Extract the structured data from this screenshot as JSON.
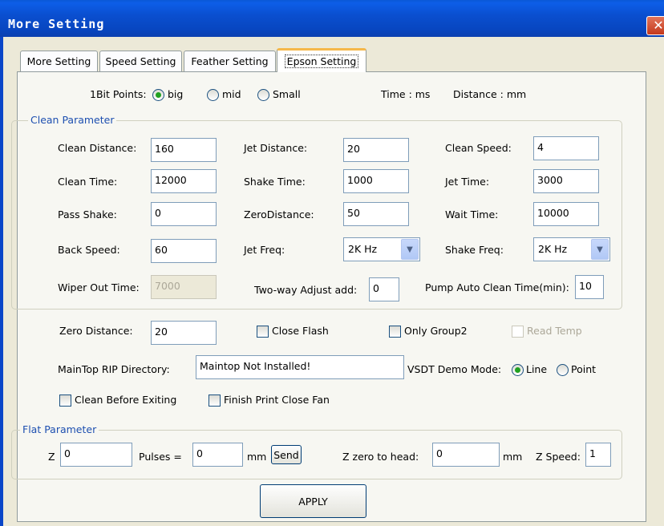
{
  "window": {
    "title": "More Setting",
    "close_glyph": "✕"
  },
  "tabs": [
    {
      "label": "More Setting"
    },
    {
      "label": "Speed Setting"
    },
    {
      "label": "Feather Setting"
    },
    {
      "label": "Epson Setting"
    }
  ],
  "bit_points": {
    "label": "1Bit Points:",
    "options": [
      "big",
      "mid",
      "Small"
    ],
    "selected": "big",
    "time_unit": "Time : ms",
    "distance_unit": "Distance : mm"
  },
  "clean": {
    "group_title": "Clean Parameter",
    "clean_distance": {
      "label": "Clean Distance:",
      "value": "160"
    },
    "jet_distance": {
      "label": "Jet Distance:",
      "value": "20"
    },
    "clean_speed": {
      "label": "Clean Speed:",
      "value": "4"
    },
    "clean_time": {
      "label": "Clean Time:",
      "value": "12000"
    },
    "shake_time": {
      "label": "Shake Time:",
      "value": "1000"
    },
    "jet_time": {
      "label": "Jet Time:",
      "value": "3000"
    },
    "pass_shake": {
      "label": "Pass Shake:",
      "value": "0"
    },
    "zero_distance": {
      "label": "ZeroDistance:",
      "value": "50"
    },
    "wait_time": {
      "label": "Wait Time:",
      "value": "10000"
    },
    "back_speed": {
      "label": "Back Speed:",
      "value": "60"
    },
    "jet_freq": {
      "label": "Jet Freq:",
      "value": "2K Hz"
    },
    "shake_freq": {
      "label": "Shake Freq:",
      "value": "2K Hz"
    },
    "wiper_out_time": {
      "label": "Wiper Out Time:",
      "value": "7000"
    },
    "two_way_adjust": {
      "label": "Two-way Adjust add:",
      "value": "0"
    },
    "pump_auto_clean": {
      "label": "Pump Auto Clean Time(min):",
      "value": "10"
    }
  },
  "misc": {
    "zero_distance": {
      "label": "Zero Distance:",
      "value": "20"
    },
    "close_flash": {
      "label": "Close Flash",
      "checked": false
    },
    "only_group2": {
      "label": "Only Group2",
      "checked": false
    },
    "read_temp": {
      "label": "Read Temp",
      "checked": false
    },
    "maintop_dir": {
      "label": "MainTop RIP Directory:",
      "value": "Maintop Not Installed!"
    },
    "vsdt_mode": {
      "label": "VSDT Demo Mode:",
      "options": [
        "Line",
        "Point"
      ],
      "selected": "Line"
    },
    "clean_before_exit": {
      "label": "Clean Before Exiting",
      "checked": false
    },
    "finish_close_fan": {
      "label": "Finish Print Close Fan",
      "checked": false
    }
  },
  "flat": {
    "group_title": "Flat Parameter",
    "z_label": "Z",
    "z_value": "0",
    "pulses_label": "Pulses =",
    "mm_value": "0",
    "mm_label": "mm",
    "send_label": "Send",
    "z_zero_label": "Z zero to head:",
    "z_zero_value": "0",
    "z_zero_unit": "mm",
    "z_speed_label": "Z Speed:",
    "z_speed_value": "1"
  },
  "apply_label": "APPLY",
  "colors": {
    "title_bar": "#0a4fd0",
    "active_tab_accent": "#f5b84a",
    "group_title": "#1d4fb0"
  }
}
